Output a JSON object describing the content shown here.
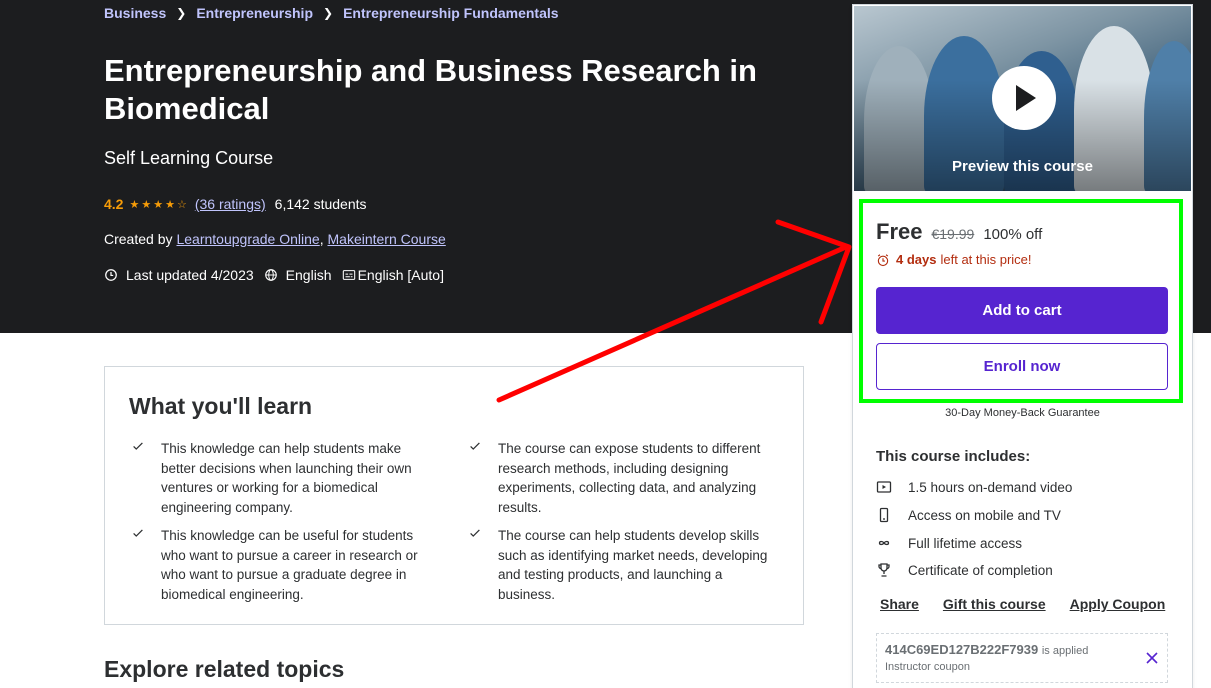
{
  "breadcrumb": [
    "Business",
    "Entrepreneurship",
    "Entrepreneurship Fundamentals"
  ],
  "course": {
    "title": "Entrepreneurship and Business Research in Biomedical",
    "subtitle": "Self Learning Course",
    "rating": "4.2",
    "rating_count": "(36 ratings)",
    "students": "6,142 students",
    "created_label": "Created by",
    "instructors": [
      "Learntoupgrade Online",
      "Makeintern Course"
    ],
    "last_updated": "Last updated 4/2023",
    "language": "English",
    "captions": "English [Auto]"
  },
  "learn": {
    "title": "What you'll learn",
    "items": [
      "This knowledge can help students make better decisions when launching their own ventures or working for a biomedical engineering company.",
      "The course can expose students to different research methods, including designing experiments, collecting data, and analyzing results.",
      "This knowledge can be useful for students who want to pursue a career in research or who want to pursue a graduate degree in biomedical engineering.",
      "The course can help students develop skills such as identifying market needs, developing and testing products, and launching a business."
    ]
  },
  "related_title": "Explore related topics",
  "sidebar": {
    "preview_label": "Preview this course",
    "price": "Free",
    "original_price": "€19.99",
    "discount": "100% off",
    "timer_bold": "4 days",
    "timer_rest": "left at this price!",
    "add_to_cart": "Add to cart",
    "enroll_now": "Enroll now",
    "guarantee": "30-Day Money-Back Guarantee",
    "includes_title": "This course includes:",
    "includes": [
      {
        "icon": "video-icon",
        "label": "1.5 hours on-demand video"
      },
      {
        "icon": "mobile-icon",
        "label": "Access on mobile and TV"
      },
      {
        "icon": "infinity-icon",
        "label": "Full lifetime access"
      },
      {
        "icon": "trophy-icon",
        "label": "Certificate of completion"
      }
    ],
    "links": [
      "Share",
      "Gift this course",
      "Apply Coupon"
    ],
    "coupon_code": "414C69ED127B222F7939",
    "coupon_applied": "is applied",
    "coupon_type": "Instructor coupon"
  },
  "colors": {
    "hero_bg": "#1c1d1f",
    "brand_purple": "#5624d0",
    "star": "#f69c08",
    "link": "#c0c4fc",
    "timer": "#b32d0f",
    "highlight": "#00ff00",
    "arrow": "#ff0000"
  }
}
